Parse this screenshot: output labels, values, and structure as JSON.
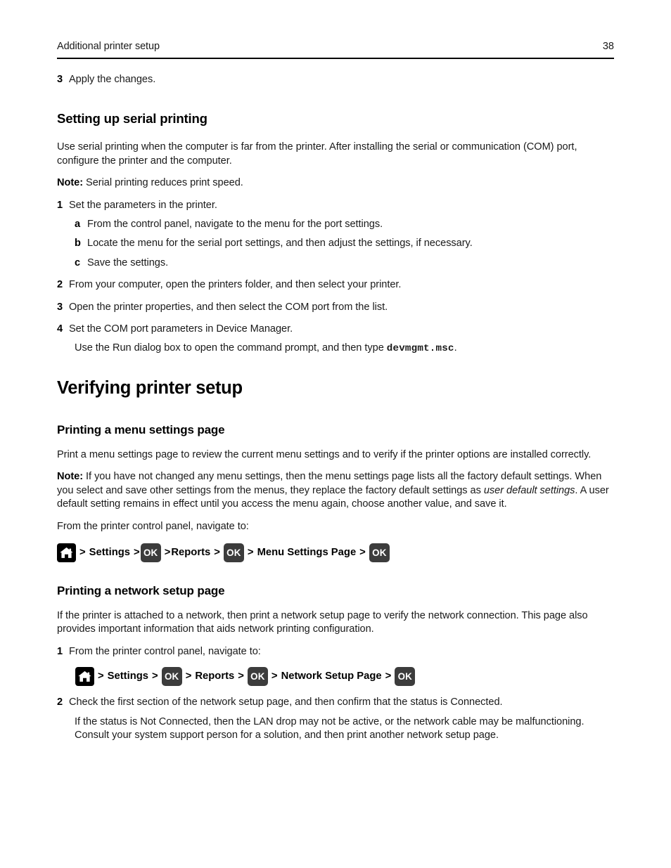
{
  "header": {
    "title": "Additional printer setup",
    "page_number": "38"
  },
  "colors": {
    "text": "#1a1a1a",
    "heading": "#000000",
    "rule": "#000000",
    "home_icon_bg": "#000000",
    "ok_key_bg": "#3c3c3c",
    "ok_key_text": "#ffffff"
  },
  "blocks": {
    "step3_apply": {
      "number": "3",
      "text": "Apply the changes."
    },
    "serial_heading": "Setting up serial printing",
    "serial_intro": "Use serial printing when the computer is far from the printer. After installing the serial or communication (COM) port, configure the printer and the computer.",
    "serial_note": {
      "label": "Note:",
      "text": " Serial printing reduces print speed."
    },
    "serial_steps": {
      "s1": {
        "number": "1",
        "text": "Set the parameters in the printer."
      },
      "s1a": {
        "letter": "a",
        "text": "From the control panel, navigate to the menu for the port settings."
      },
      "s1b": {
        "letter": "b",
        "text": "Locate the menu for the serial port settings, and then adjust the settings, if necessary."
      },
      "s1c": {
        "letter": "c",
        "text": "Save the settings."
      },
      "s2": {
        "number": "2",
        "text": "From your computer, open the printers folder, and then select your printer."
      },
      "s3": {
        "number": "3",
        "text": "Open the printer properties, and then select the COM port from the list."
      },
      "s4": {
        "number": "4",
        "text": "Set the COM port parameters in Device Manager."
      },
      "s4_cont_pre": "Use the Run dialog box to open the command prompt, and then type ",
      "s4_cont_code": "devmgmt.msc",
      "s4_cont_post": "."
    },
    "verifying_heading": "Verifying printer setup",
    "menu_settings": {
      "heading": "Printing a menu settings page",
      "intro": "Print a menu settings page to review the current menu settings and to verify if the printer options are installed correctly.",
      "note_label": "Note:",
      "note_part1": " If you have not changed any menu settings, then the menu settings page lists all the factory default settings. When you select and save other settings from the menus, they replace the factory default settings as ",
      "note_italic": "user default settings",
      "note_part2": ". A user default setting remains in effect until you access the menu again, choose another value, and save it.",
      "navigate_lead": "From the printer control panel, navigate to:",
      "nav": {
        "home_icon": "home-icon",
        "sep1": ">",
        "label1": "Settings",
        "sep2": ">",
        "ok1": "OK",
        "sep3": ">",
        "label2": "Reports",
        "sep4": ">",
        "ok2": "OK",
        "sep5": ">",
        "label3": "Menu Settings Page",
        "sep6": ">",
        "ok3": "OK"
      }
    },
    "network_setup": {
      "heading": "Printing a network setup page",
      "intro": "If the printer is attached to a network, then print a network setup page to verify the network connection. This page also provides important information that aids network printing configuration.",
      "step1": {
        "number": "1",
        "text": "From the printer control panel, navigate to:"
      },
      "nav": {
        "home_icon": "home-icon",
        "sep1": ">",
        "label1": "Settings",
        "sep2": ">",
        "ok1": "OK",
        "sep3": ">",
        "label2": "Reports",
        "sep4": ">",
        "ok2": "OK",
        "sep5": ">",
        "label3": "Network Setup Page",
        "sep6": ">",
        "ok3": "OK"
      },
      "step2": {
        "number": "2",
        "text": "Check the first section of the network setup page, and then confirm that the status is Connected."
      },
      "step2_cont": "If the status is Not Connected, then the LAN drop may not be active, or the network cable may be malfunctioning. Consult your system support person for a solution, and then print another network setup page."
    }
  }
}
